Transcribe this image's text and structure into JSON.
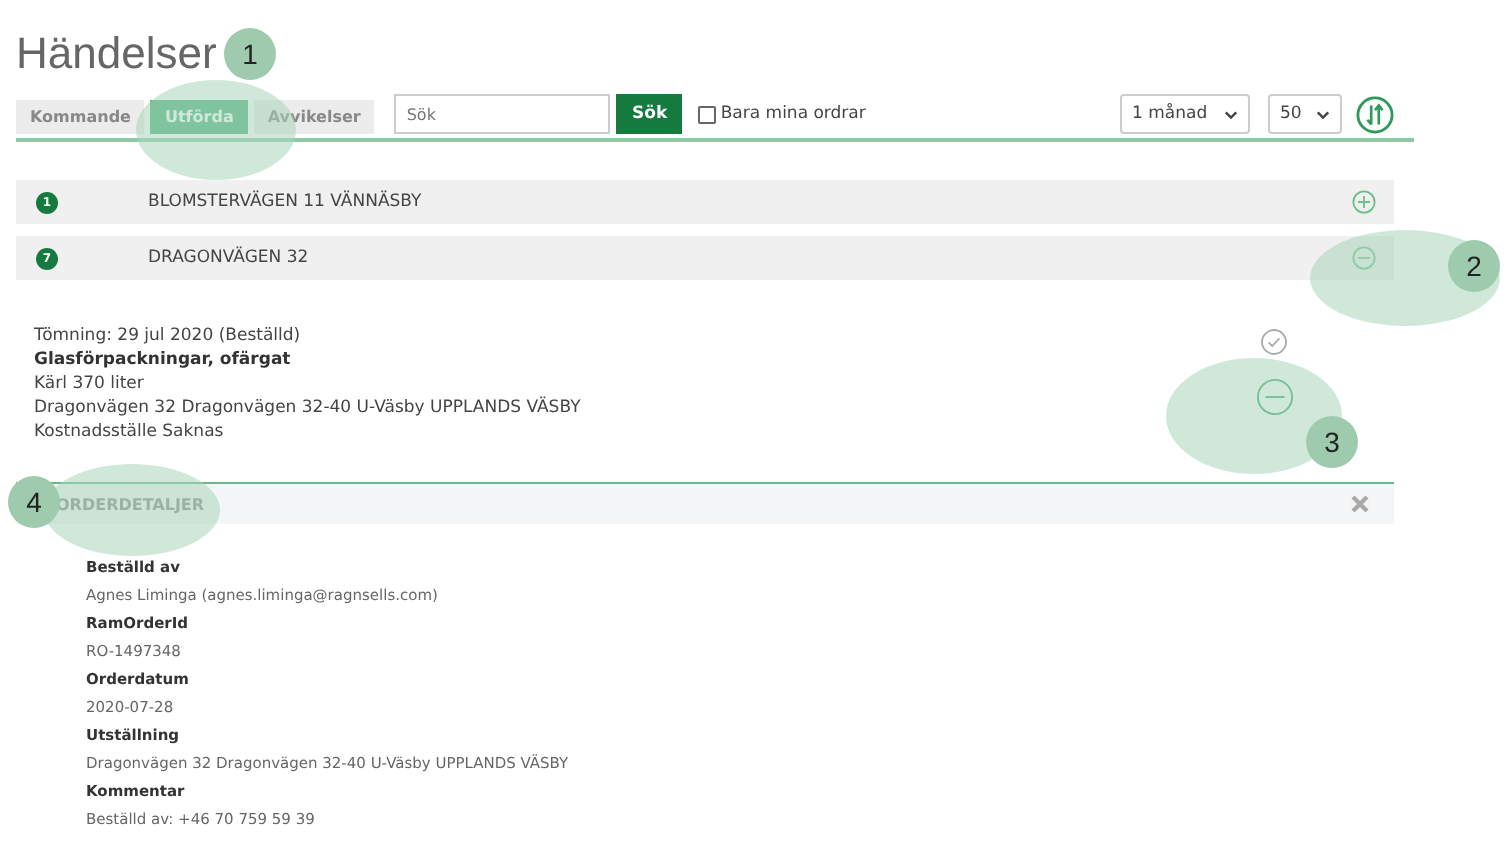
{
  "page_title": "Händelser",
  "tabs": [
    {
      "label": "Kommande",
      "selected": false
    },
    {
      "label": "Utförda",
      "selected": true
    },
    {
      "label": "Avvikelser",
      "selected": false
    }
  ],
  "search": {
    "placeholder": "Sök",
    "button": "Sök"
  },
  "filter_checkbox": {
    "label": "Bara mina ordrar",
    "checked": false
  },
  "period_select": {
    "value": "1 månad"
  },
  "count_select": {
    "value": "50"
  },
  "locations": [
    {
      "badge": "1",
      "name": "BLOMSTERVÄGEN 11 VÄNNÄSBY",
      "expanded": false
    },
    {
      "badge": "7",
      "name": "DRAGONVÄGEN 32",
      "expanded": true
    }
  ],
  "order": {
    "title": "Tömning: 29 jul 2020 (Beställd)",
    "product": "Glasförpackningar, ofärgat",
    "lines": [
      "Kärl 370 liter",
      "Dragonvägen 32 Dragonvägen 32-40 U-Väsby UPPLANDS VÄSBY",
      "Kostnadsställe Saknas"
    ],
    "expanded": true
  },
  "order_details": {
    "title": "ORDERDETALJER",
    "fields": [
      {
        "label": "Beställd av",
        "value": "Agnes Liminga (agnes.liminga@ragnsells.com)"
      },
      {
        "label": "RamOrderId",
        "value": "RO-1497348"
      },
      {
        "label": "Orderdatum",
        "value": "2020-07-28"
      },
      {
        "label": "Utställning",
        "value": "Dragonvägen 32 Dragonvägen 32-40 U-Väsby UPPLANDS VÄSBY"
      },
      {
        "label": "Kommentar",
        "value": "Beställd av: +46 70 759 59 39"
      }
    ]
  },
  "callouts": [
    {
      "number": "1"
    },
    {
      "number": "2"
    },
    {
      "number": "3"
    },
    {
      "number": "4"
    }
  ]
}
